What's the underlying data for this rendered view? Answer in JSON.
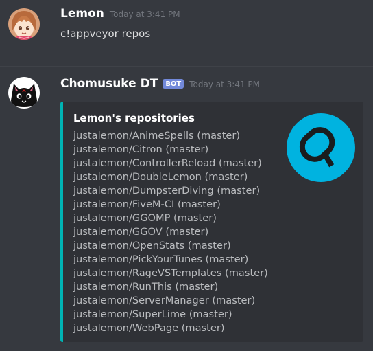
{
  "messages": [
    {
      "author": "Lemon",
      "timestamp": "Today at 3:41 PM",
      "content": "c!appveyor repos",
      "avatar": "anime-girl-avatar"
    },
    {
      "author": "Chomusuke DT",
      "bot_tag": "BOT",
      "timestamp": "Today at 3:41 PM",
      "avatar": "black-cat-avatar",
      "embed": {
        "accent_color": "#00b3b3",
        "title": "Lemon's repositories",
        "thumbnail": "appveyor-logo-icon",
        "repos": [
          "justalemon/AnimeSpells (master)",
          "justalemon/Citron (master)",
          "justalemon/ControllerReload (master)",
          "justalemon/DoubleLemon (master)",
          "justalemon/DumpsterDiving (master)",
          "justalemon/FiveM-CI (master)",
          "justalemon/GGOMP (master)",
          "justalemon/GGOV (master)",
          "justalemon/OpenStats (master)",
          "justalemon/PickYourTunes (master)",
          "justalemon/RageVSTemplates (master)",
          "justalemon/RunThis (master)",
          "justalemon/ServerManager (master)",
          "justalemon/SuperLime (master)",
          "justalemon/WebPage (master)"
        ]
      }
    }
  ],
  "colors": {
    "background": "#36393f",
    "embed_background": "#2f3136",
    "bot_tag": "#7289da",
    "appveyor_blue": "#00b3e0"
  }
}
